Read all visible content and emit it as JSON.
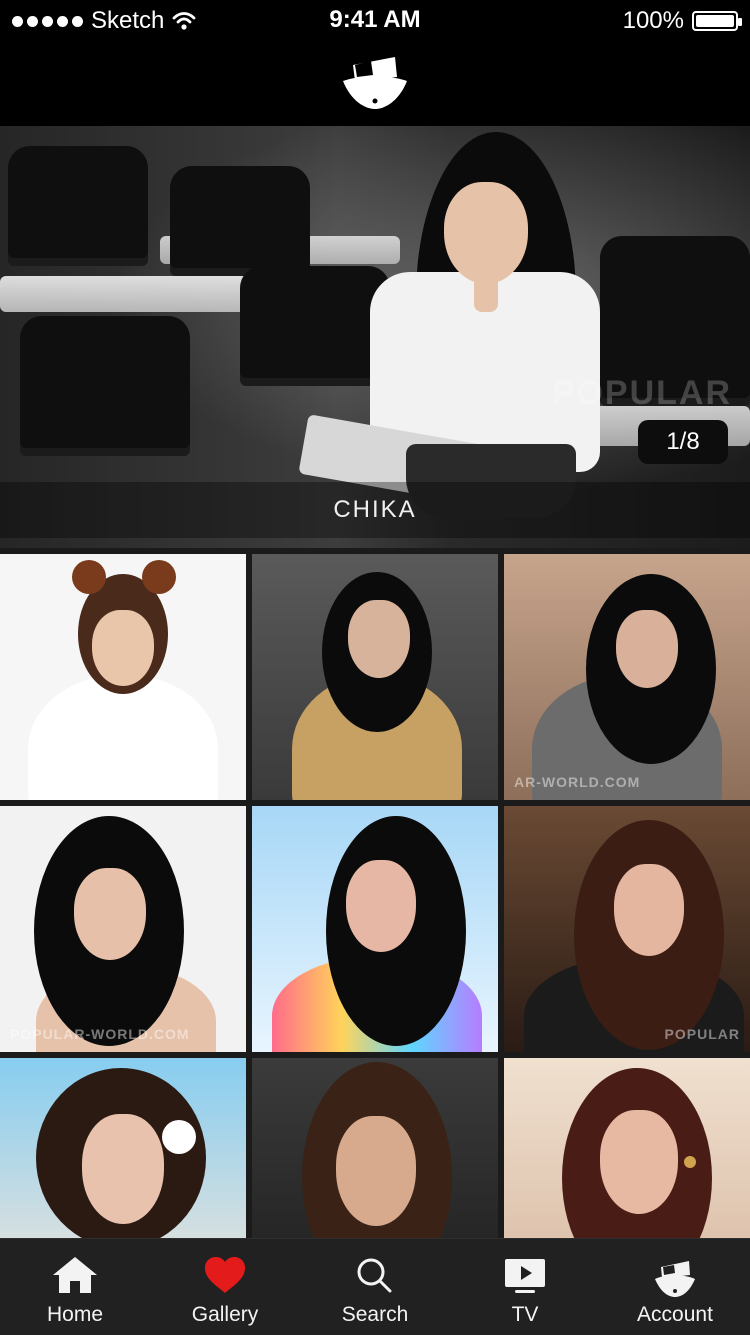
{
  "status_bar": {
    "carrier": "Sketch",
    "time": "9:41 AM",
    "battery": "100%"
  },
  "hero": {
    "pager_text": "1/8",
    "caption": "CHIKA",
    "watermark": "POPULAR"
  },
  "grid": {
    "tiles": [
      {
        "label": "tile-1"
      },
      {
        "label": "tile-2"
      },
      {
        "label": "tile-3",
        "watermark": "AR-WORLD.COM"
      },
      {
        "label": "tile-4",
        "watermark": "POPULAR-WORLD.COM"
      },
      {
        "label": "tile-5"
      },
      {
        "label": "tile-6",
        "watermark": "POPULAR"
      },
      {
        "label": "tile-7"
      },
      {
        "label": "tile-8"
      },
      {
        "label": "tile-9"
      }
    ]
  },
  "tabs": [
    {
      "label": "Home",
      "icon": "home-icon",
      "active": false
    },
    {
      "label": "Gallery",
      "icon": "heart-icon",
      "active": true
    },
    {
      "label": "Search",
      "icon": "search-icon",
      "active": false
    },
    {
      "label": "TV",
      "icon": "tv-icon",
      "active": false
    },
    {
      "label": "Account",
      "icon": "account-icon",
      "active": false
    }
  ],
  "colors": {
    "accent": "#e31b1b",
    "tabbar_bg": "#212121",
    "header_bg": "#000000"
  }
}
